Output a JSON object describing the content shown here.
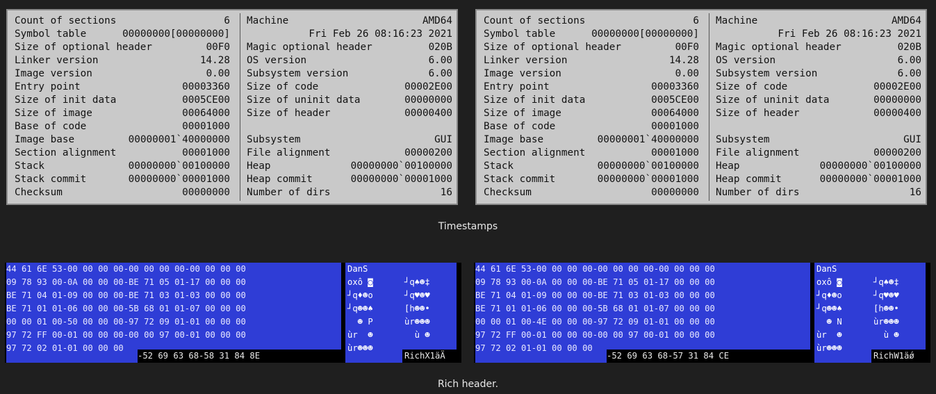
{
  "panels": [
    {
      "left": [
        {
          "k": "Count of sections",
          "v": "6"
        },
        {
          "k": "Symbol table",
          "v": "00000000[00000000]"
        },
        {
          "k": "Size of optional header",
          "v": "00F0"
        },
        {
          "k": "Linker version",
          "v": "14.28"
        },
        {
          "k": "Image version",
          "v": "0.00"
        },
        {
          "k": "Entry point",
          "v": "00003360"
        },
        {
          "k": "Size of init data",
          "v": "0005CE00"
        },
        {
          "k": "Size of image",
          "v": "00064000"
        },
        {
          "k": "Base of code",
          "v": "00001000"
        },
        {
          "k": "Image base",
          "v": "00000001`40000000"
        },
        {
          "k": "Section alignment",
          "v": "00001000"
        },
        {
          "k": "Stack",
          "v": "00000000`00100000"
        },
        {
          "k": "Stack commit",
          "v": "00000000`00001000"
        },
        {
          "k": "Checksum",
          "v": "00000000"
        }
      ],
      "right": [
        {
          "k": "Machine",
          "v": "AMD64"
        },
        {
          "k": "",
          "v": "Fri Feb 26 08:16:23 2021"
        },
        {
          "k": "Magic optional header",
          "v": "020B"
        },
        {
          "k": "OS version",
          "v": "6.00"
        },
        {
          "k": "Subsystem version",
          "v": "6.00"
        },
        {
          "k": "Size of code",
          "v": "00002E00"
        },
        {
          "k": "Size of uninit data",
          "v": "00000000"
        },
        {
          "k": "Size of header",
          "v": "00000400"
        },
        {
          "k": "",
          "v": ""
        },
        {
          "k": "Subsystem",
          "v": "GUI"
        },
        {
          "k": "File alignment",
          "v": "00000200"
        },
        {
          "k": "Heap",
          "v": "00000000`00100000"
        },
        {
          "k": "Heap commit",
          "v": "00000000`00001000"
        },
        {
          "k": "Number of dirs",
          "v": "16"
        }
      ]
    },
    {
      "left": [
        {
          "k": "Count of sections",
          "v": "6"
        },
        {
          "k": "Symbol table",
          "v": "00000000[00000000]"
        },
        {
          "k": "Size of optional header",
          "v": "00F0"
        },
        {
          "k": "Linker version",
          "v": "14.28"
        },
        {
          "k": "Image version",
          "v": "0.00"
        },
        {
          "k": "Entry point",
          "v": "00003360"
        },
        {
          "k": "Size of init data",
          "v": "0005CE00"
        },
        {
          "k": "Size of image",
          "v": "00064000"
        },
        {
          "k": "Base of code",
          "v": "00001000"
        },
        {
          "k": "Image base",
          "v": "00000001`40000000"
        },
        {
          "k": "Section alignment",
          "v": "00001000"
        },
        {
          "k": "Stack",
          "v": "00000000`00100000"
        },
        {
          "k": "Stack commit",
          "v": "00000000`00001000"
        },
        {
          "k": "Checksum",
          "v": "00000000"
        }
      ],
      "right": [
        {
          "k": "Machine",
          "v": "AMD64"
        },
        {
          "k": "",
          "v": "Fri Feb 26 08:16:23 2021"
        },
        {
          "k": "Magic optional header",
          "v": "020B"
        },
        {
          "k": "OS version",
          "v": "6.00"
        },
        {
          "k": "Subsystem version",
          "v": "6.00"
        },
        {
          "k": "Size of code",
          "v": "00002E00"
        },
        {
          "k": "Size of uninit data",
          "v": "00000000"
        },
        {
          "k": "Size of header",
          "v": "00000400"
        },
        {
          "k": "",
          "v": ""
        },
        {
          "k": "Subsystem",
          "v": "GUI"
        },
        {
          "k": "File alignment",
          "v": "00000200"
        },
        {
          "k": "Heap",
          "v": "00000000`00100000"
        },
        {
          "k": "Heap commit",
          "v": "00000000`00001000"
        },
        {
          "k": "Number of dirs",
          "v": "16"
        }
      ]
    }
  ],
  "captions": {
    "timestamps": "Timestamps",
    "rich": "Rich header."
  },
  "hex": [
    {
      "rows": [
        "44 61 6E 53-00 00 00 00-00 00 00 00-00 00 00 00",
        "09 78 93 00-0A 00 00 00-BE 71 05 01-17 00 00 00",
        "BE 71 04 01-09 00 00 00-BE 71 03 01-03 00 00 00",
        "BE 71 01 01-06 00 00 00-5B 68 01 01-07 00 00 00",
        "00 00 01 00-50 00 00 00-97 72 09 01-01 00 00 00",
        "97 72 FF 00-01 00 00 00-00 00 97 00-01 00 00 00"
      ],
      "last_hi": "97 72 02 01-01 00 00 00",
      "last_lo": "-52 69 63 68-58 31 84 8E",
      "ascii1": [
        "DanS",
        "oxô ◙",
        "┘q♦☻o",
        "┘q☻☻♠",
        "  ☻ P",
        "ùr  ☻"
      ],
      "ascii2": [
        "",
        "┘q♠☻‡",
        "┘q♥☻♥",
        "[h☻☻•",
        "ùr☻☻☻",
        "  ù ☻"
      ],
      "ascii1_last": "ùr☻☻☻",
      "ascii2_last": "RichX1äÄ"
    },
    {
      "rows": [
        "44 61 6E 53-00 00 00 00-00 00 00 00-00 00 00 00",
        "09 78 93 00-0A 00 00 00-BE 71 05 01-17 00 00 00",
        "BE 71 04 01-09 00 00 00-BE 71 03 01-03 00 00 00",
        "BE 71 01 01-06 00 00 00-5B 68 01 01-07 00 00 00",
        "00 00 01 00-4E 00 00 00-97 72 09 01-01 00 00 00",
        "97 72 FF 00-01 00 00 00-00 00 97 00-01 00 00 00"
      ],
      "last_hi": "97 72 02 01-01 00 00 00",
      "last_lo": "-52 69 63 68-57 31 84 CE",
      "ascii1": [
        "DanS",
        "oxô ◙",
        "┘q♦☻o",
        "┘q☻☻♠",
        "  ☻ N",
        "ùr  ☻"
      ],
      "ascii2": [
        "",
        "┘q♠☻‡",
        "┘q♥☻♥",
        "[h☻☻•",
        "ùr☻☻☻",
        "  ù ☻"
      ],
      "ascii1_last": "ùr☻☻☻",
      "ascii2_last": "RichW1äǿ"
    }
  ]
}
